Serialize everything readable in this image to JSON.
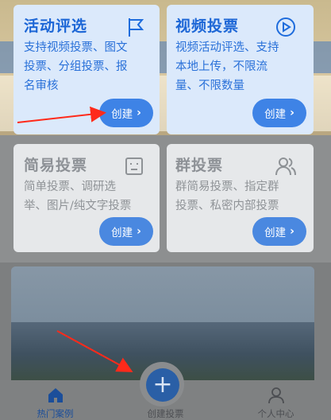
{
  "cards": [
    {
      "title": "活动评选",
      "desc": [
        "支持视频投票、图文",
        "投票、分组投票、报",
        "名审核"
      ],
      "button": "创建",
      "icon": "flag-icon"
    },
    {
      "title": "视频投票",
      "desc": [
        "视频活动评选、支持",
        "本地上传，不限流",
        "量、不限数量"
      ],
      "button": "创建",
      "icon": "play-circle-icon"
    },
    {
      "title": "简易投票",
      "desc": [
        "简单投票、调研选",
        "举、图片/纯文字投票"
      ],
      "button": "创建",
      "icon": "ballot-box-icon"
    },
    {
      "title": "群投票",
      "desc": [
        "群简易投票、指定群",
        "投票、私密内部投票"
      ],
      "button": "创建",
      "icon": "group-users-icon"
    }
  ],
  "tabbar": {
    "items": [
      {
        "label": "热门案例",
        "icon": "home-icon"
      },
      {
        "label": "创建投票",
        "icon": "plus-icon"
      },
      {
        "label": "个人中心",
        "icon": "person-icon"
      }
    ]
  },
  "colors": {
    "accent": "#3e83e6",
    "active_card": "#dbe9fb",
    "dim_card": "#e6e8ea"
  }
}
